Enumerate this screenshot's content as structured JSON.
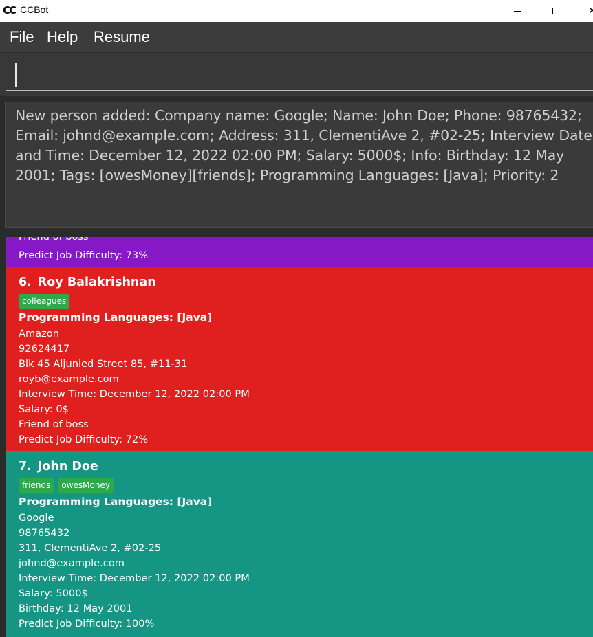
{
  "window": {
    "title": "CCBot",
    "icon": "ccbot-logo-icon",
    "controls": [
      "minimize-icon",
      "maximize-icon",
      "close-icon"
    ]
  },
  "menu": {
    "file": "File",
    "help": "Help",
    "resume": "Resume"
  },
  "command": {
    "value": ""
  },
  "result": {
    "text": "New person added: Company name: Google; Name: John Doe; Phone: 98765432; Email: johnd@example.com; Address: 311, ClementiAve 2, #02-25; Interview Date and Time: December 12, 2022 02:00 PM; Salary: 5000$; Info: Birthday: 12 May 2001; Tags: [owesMoney][friends]; Programming Languages: [Java]; Priority: 2"
  },
  "colors": {
    "purple_card": "#8718c6",
    "red_card": "#e01f1f",
    "teal_card": "#159584",
    "tag": "#2ea84a"
  },
  "persons": [
    {
      "partial": true,
      "info": "Friend of boss",
      "difficulty": "Predict Job Difficulty: 73%"
    },
    {
      "index": "6.",
      "name": "Roy Balakrishnan",
      "tags": [
        "colleagues"
      ],
      "languages": "Programming Languages: [Java]",
      "company": "Amazon",
      "phone": "92624417",
      "address": "Blk 45 Aljunied Street 85, #11-31",
      "email": "royb@example.com",
      "interview": "Interview Time: December 12, 2022 02:00 PM",
      "salary": "Salary: 0$",
      "info": "Friend of boss",
      "difficulty": "Predict Job Difficulty: 72%"
    },
    {
      "index": "7.",
      "name": "John Doe",
      "tags": [
        "friends",
        "owesMoney"
      ],
      "languages": "Programming Languages: [Java]",
      "company": "Google",
      "phone": "98765432",
      "address": "311, ClementiAve 2, #02-25",
      "email": "johnd@example.com",
      "interview": "Interview Time: December 12, 2022 02:00 PM",
      "salary": "Salary: 5000$",
      "info": "Birthday: 12 May 2001",
      "difficulty": "Predict Job Difficulty: 100%"
    }
  ]
}
